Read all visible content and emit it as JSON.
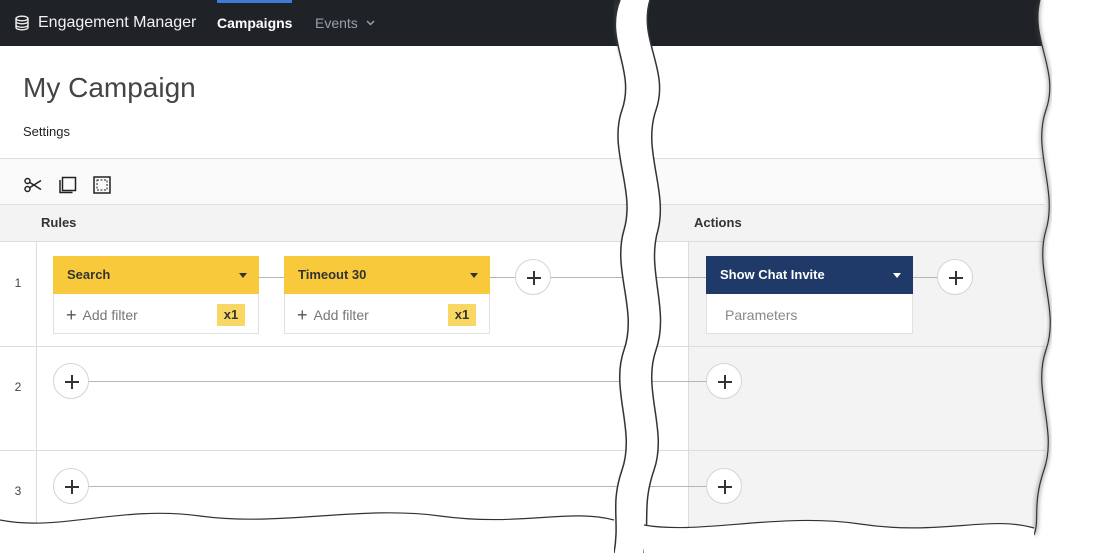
{
  "nav": {
    "app_name": "Engagement Manager",
    "campaigns": "Campaigns",
    "events": "Events"
  },
  "header": {
    "title": "My Campaign",
    "settings": "Settings"
  },
  "toolbar": {
    "tools": [
      "scissors-icon",
      "copy-icon",
      "select-all-icon"
    ]
  },
  "columns": {
    "rules": "Rules",
    "actions": "Actions"
  },
  "rows": [
    {
      "number": "1",
      "rules": [
        {
          "name": "Search",
          "add_filter": "Add filter",
          "count": "x1"
        },
        {
          "name": "Timeout 30",
          "add_filter": "Add filter",
          "count": "x1"
        }
      ],
      "action": {
        "name": "Show Chat Invite",
        "parameters": "Parameters"
      }
    },
    {
      "number": "2"
    },
    {
      "number": "3"
    }
  ],
  "colors": {
    "nav_bg": "#1f2227",
    "rule_header": "#f9c93c",
    "action_header": "#1f3a68",
    "badge": "#f9d763"
  }
}
